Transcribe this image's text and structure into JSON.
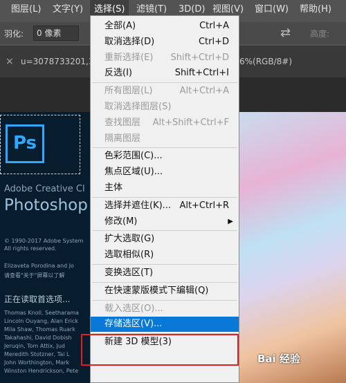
{
  "menubar": {
    "items": [
      {
        "label": "图层(L)",
        "active": false
      },
      {
        "label": "文字(Y)",
        "active": false
      },
      {
        "label": "选择(S)",
        "active": true
      },
      {
        "label": "滤镜(T)",
        "active": false
      },
      {
        "label": "3D(D)",
        "active": false
      },
      {
        "label": "视图(V)",
        "active": false
      },
      {
        "label": "窗口(W)",
        "active": false
      },
      {
        "label": "帮助(H)",
        "active": false
      }
    ]
  },
  "options": {
    "feather_label": "羽化:",
    "feather_value": "0 像素",
    "height_label": "高度:"
  },
  "tabs": {
    "doc1": "u=3078733201,3",
    "doc2": "6%(RGB/8#)",
    "close": "×"
  },
  "splash": {
    "logo": "Ps",
    "brand_line1": "Adobe Creative Cl",
    "brand_line2": "Photoshop",
    "copyright": "© 1990-2017 Adobe System",
    "rights": "All rights reserved.",
    "credits1": "Elizaveta Porodina and Jo",
    "credits2": "请查看\"关于\"屏幕以了解",
    "loading": "正在读取首选项...",
    "names": [
      "Thomas Knoll, Seetharama",
      "Lincoln Ouyang, Alan Erick",
      "Mila Shaw, Thomas Ruark",
      "Takahashi, David Dobish",
      "Jeruqin, Tom Attix, Jud",
      "Meredith Stotzner, Tai L",
      "John Worthington, Mark",
      "Winston Hendrickson, Pete"
    ]
  },
  "select_menu": {
    "items": [
      {
        "type": "item",
        "label": "全部(A)",
        "shortcut": "Ctrl+A",
        "disabled": false
      },
      {
        "type": "item",
        "label": "取消选择(D)",
        "shortcut": "Ctrl+D",
        "disabled": false
      },
      {
        "type": "item",
        "label": "重新选择(E)",
        "shortcut": "Shift+Ctrl+D",
        "disabled": true
      },
      {
        "type": "item",
        "label": "反选(I)",
        "shortcut": "Shift+Ctrl+I",
        "disabled": false
      },
      {
        "type": "sep"
      },
      {
        "type": "item",
        "label": "所有图层(L)",
        "shortcut": "Alt+Ctrl+A",
        "disabled": true
      },
      {
        "type": "item",
        "label": "取消选择图层(S)",
        "shortcut": "",
        "disabled": true
      },
      {
        "type": "item",
        "label": "查找图层",
        "shortcut": "Alt+Shift+Ctrl+F",
        "disabled": true
      },
      {
        "type": "item",
        "label": "隔离图层",
        "shortcut": "",
        "disabled": true
      },
      {
        "type": "sep"
      },
      {
        "type": "item",
        "label": "色彩范围(C)...",
        "shortcut": "",
        "disabled": false
      },
      {
        "type": "item",
        "label": "焦点区域(U)...",
        "shortcut": "",
        "disabled": false
      },
      {
        "type": "item",
        "label": "主体",
        "shortcut": "",
        "disabled": false
      },
      {
        "type": "sep"
      },
      {
        "type": "item",
        "label": "选择并遮住(K)...",
        "shortcut": "Alt+Ctrl+R",
        "disabled": false
      },
      {
        "type": "item",
        "label": "修改(M)",
        "shortcut": "",
        "disabled": false,
        "submenu": true
      },
      {
        "type": "sep"
      },
      {
        "type": "item",
        "label": "扩大选取(G)",
        "shortcut": "",
        "disabled": false
      },
      {
        "type": "item",
        "label": "选取相似(R)",
        "shortcut": "",
        "disabled": false
      },
      {
        "type": "sep"
      },
      {
        "type": "item",
        "label": "变换选区(T)",
        "shortcut": "",
        "disabled": false
      },
      {
        "type": "sep"
      },
      {
        "type": "item",
        "label": "在快速蒙版模式下编辑(Q)",
        "shortcut": "",
        "disabled": false
      },
      {
        "type": "sep"
      },
      {
        "type": "item",
        "label": "载入选区(O)...",
        "shortcut": "",
        "disabled": true
      },
      {
        "type": "item",
        "label": "存储选区(V)...",
        "shortcut": "",
        "disabled": false,
        "highlight": true
      },
      {
        "type": "sep"
      },
      {
        "type": "item",
        "label": "新建 3D 模型(3)",
        "shortcut": "",
        "disabled": false
      }
    ]
  },
  "watermark": "Bai 经验"
}
